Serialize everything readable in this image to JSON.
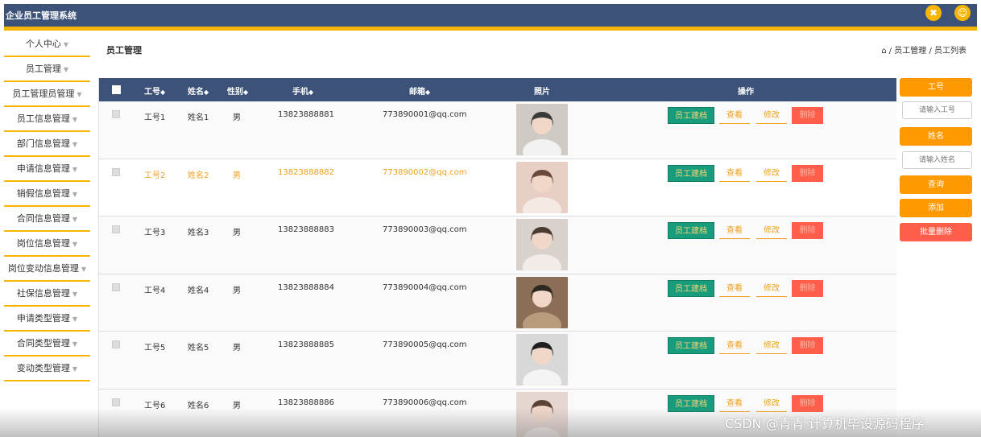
{
  "header": {
    "title": "企业员工管理系统",
    "icon_close": "✖",
    "icon_user": "☺"
  },
  "sidebar": {
    "items": [
      {
        "label": "个人中心"
      },
      {
        "label": "员工管理"
      },
      {
        "label": "员工管理员管理"
      },
      {
        "label": "员工信息管理"
      },
      {
        "label": "部门信息管理"
      },
      {
        "label": "申请信息管理"
      },
      {
        "label": "销假信息管理"
      },
      {
        "label": "合同信息管理"
      },
      {
        "label": "岗位信息管理"
      },
      {
        "label": "岗位变动信息管理"
      },
      {
        "label": "社保信息管理"
      },
      {
        "label": "申请类型管理"
      },
      {
        "label": "合同类型管理"
      },
      {
        "label": "变动类型管理"
      }
    ],
    "arrow": "▼"
  },
  "page": {
    "title": "员工管理",
    "breadcrumb": "/ 员工管理 / 员工列表",
    "home_icon": "⌂"
  },
  "table": {
    "columns": {
      "id": "工号",
      "name": "姓名",
      "gender": "性别",
      "phone": "手机",
      "email": "邮箱",
      "photo": "照片",
      "actions": "操作",
      "sort": "◆"
    },
    "actions": {
      "dossier": "员工建档",
      "view": "查看",
      "edit": "修改",
      "delete": "删除"
    },
    "rows": [
      {
        "id": "工号1",
        "name": "姓名1",
        "gender": "男",
        "phone": "13823888881",
        "email": "773890001@qq.com"
      },
      {
        "id": "工号2",
        "name": "姓名2",
        "gender": "男",
        "phone": "13823888882",
        "email": "773890002@qq.com"
      },
      {
        "id": "工号3",
        "name": "姓名3",
        "gender": "男",
        "phone": "13823888883",
        "email": "773890003@qq.com"
      },
      {
        "id": "工号4",
        "name": "姓名4",
        "gender": "男",
        "phone": "13823888884",
        "email": "773890004@qq.com"
      },
      {
        "id": "工号5",
        "name": "姓名5",
        "gender": "男",
        "phone": "13823888885",
        "email": "773890005@qq.com"
      },
      {
        "id": "工号6",
        "name": "姓名6",
        "gender": "男",
        "phone": "13823888886",
        "email": "773890006@qq.com"
      }
    ],
    "highlight_row": 2
  },
  "search": {
    "id_label": "工号",
    "id_placeholder": "请输入工号",
    "name_label": "姓名",
    "name_placeholder": "请输入姓名",
    "query": "查询",
    "add": "添加",
    "batch_delete": "批量删除"
  },
  "watermark": "CSDN @青青  计算机毕设源码程序",
  "colors": {
    "primary": "#3d5279",
    "accent": "#f7b500",
    "orange": "#ff9900",
    "danger": "#ff5f4a",
    "green": "#179c7c"
  }
}
